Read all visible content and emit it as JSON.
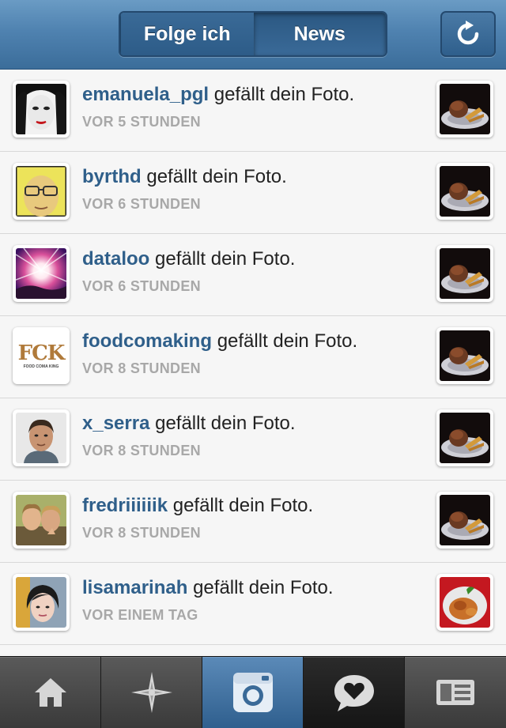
{
  "header": {
    "segments": [
      "Folge ich",
      "News"
    ],
    "active_segment": "News",
    "refresh_icon": "refresh-icon"
  },
  "feed": {
    "action_text": "gefällt dein Foto.",
    "items": [
      {
        "username": "emanuela_pgl",
        "time": "VOR 5 STUNDEN",
        "avatar": "portrait-dark-hair",
        "thumb": "food-plate-dark"
      },
      {
        "username": "byrthd",
        "time": "VOR 6 STUNDEN",
        "avatar": "portrait-yellow-glasses",
        "thumb": "food-plate-dark"
      },
      {
        "username": "dataloo",
        "time": "VOR 6 STUNDEN",
        "avatar": "sunburst-photo",
        "thumb": "food-plate-dark"
      },
      {
        "username": "foodcomaking",
        "time": "VOR 8 STUNDEN",
        "avatar": "fck-logo",
        "avatar_logo_text": "FCK",
        "avatar_logo_sub": "FOOD COMA KING",
        "thumb": "food-plate-dark"
      },
      {
        "username": "x_serra",
        "time": "VOR 8 STUNDEN",
        "avatar": "portrait-man",
        "thumb": "food-plate-dark"
      },
      {
        "username": "fredriiiiiik",
        "time": "VOR 8 STUNDEN",
        "avatar": "two-friends-photo",
        "thumb": "food-plate-dark"
      },
      {
        "username": "lisamarinah",
        "time": "VOR EINEM TAG",
        "avatar": "portrait-girl",
        "thumb": "food-red-plate"
      }
    ]
  },
  "tabbar": {
    "tabs": [
      "home-icon",
      "explore-star-icon",
      "camera-icon",
      "news-heart-bubble-icon",
      "profile-card-icon"
    ],
    "active_tab": "camera-icon"
  }
}
